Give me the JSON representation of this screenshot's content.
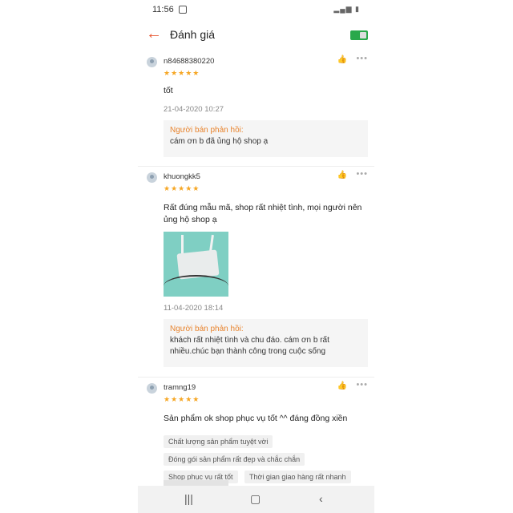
{
  "status": {
    "time": "11:56"
  },
  "header": {
    "title": "Đánh giá"
  },
  "reviews": [
    {
      "user": "n84688380220",
      "stars": "★★★★★",
      "text": "tốt",
      "date": "21-04-2020 10:27",
      "reply_label": "Người bán phản hồi:",
      "reply": "cám ơn b đã ủng hộ shop ạ"
    },
    {
      "user": "khuongkk5",
      "stars": "★★★★★",
      "text": "Rất đúng mẫu mã, shop rất nhiệt tình, mọi người nên ủng hộ shop ạ",
      "date": "11-04-2020 18:14",
      "reply_label": "Người bán phản hồi:",
      "reply": "khách rất nhiệt tình và chu đáo. cám ơn b rất nhiều.chúc bạn thành công trong cuộc sống"
    },
    {
      "user": "tramng19",
      "stars": "★★★★★",
      "text": "Sản phẩm ok shop phục vụ tốt ^^ đáng đồng xiền",
      "tags": [
        "Chất lượng sản phẩm tuyệt vời",
        "Đóng gói sản phẩm rất đẹp và chắc chắn",
        "Shop phục vụ rất tốt",
        "Thời gian giao hàng rất nhanh"
      ]
    }
  ],
  "icons": {
    "back": "back-arrow-icon",
    "like": "thumbs-up-icon",
    "more": "more-dots-icon",
    "nav_recent": "recent-apps-icon",
    "nav_home": "home-icon",
    "nav_back": "nav-back-icon"
  },
  "colors": {
    "accent": "#e8542e",
    "star": "#f6a623",
    "reply_label": "#e8842e"
  }
}
